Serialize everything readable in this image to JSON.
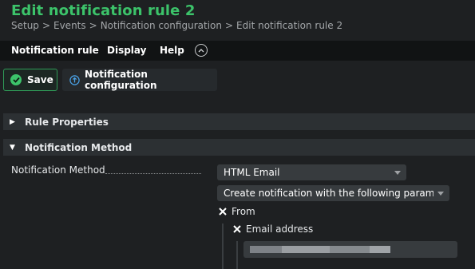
{
  "page": {
    "title": "Edit notification rule 2",
    "breadcrumb": [
      "Setup",
      "Events",
      "Notification configuration",
      "Edit notification rule 2"
    ],
    "breadcrumb_separator": ">"
  },
  "menubar": {
    "items": [
      "Notification rule",
      "Display",
      "Help"
    ],
    "collapse_icon": "chevron-up-circle-icon"
  },
  "toolbar": {
    "save_label": "Save",
    "notification_config_label": "Notification configuration"
  },
  "sections": {
    "rule_properties": {
      "label": "Rule Properties",
      "expanded": false
    },
    "notification_method": {
      "label": "Notification Method",
      "expanded": true
    }
  },
  "form": {
    "method_label": "Notification Method",
    "method_value": "HTML Email",
    "param_mode_value": "Create notification with the following param...",
    "from_label": "From",
    "email_address_label": "Email address",
    "email_value_obscured": true
  },
  "colors": {
    "accent": "#3cc36a",
    "background": "#1e2022",
    "menubar": "#111314",
    "section_bar": "#2c3033",
    "info_icon": "#4aa3e8"
  }
}
